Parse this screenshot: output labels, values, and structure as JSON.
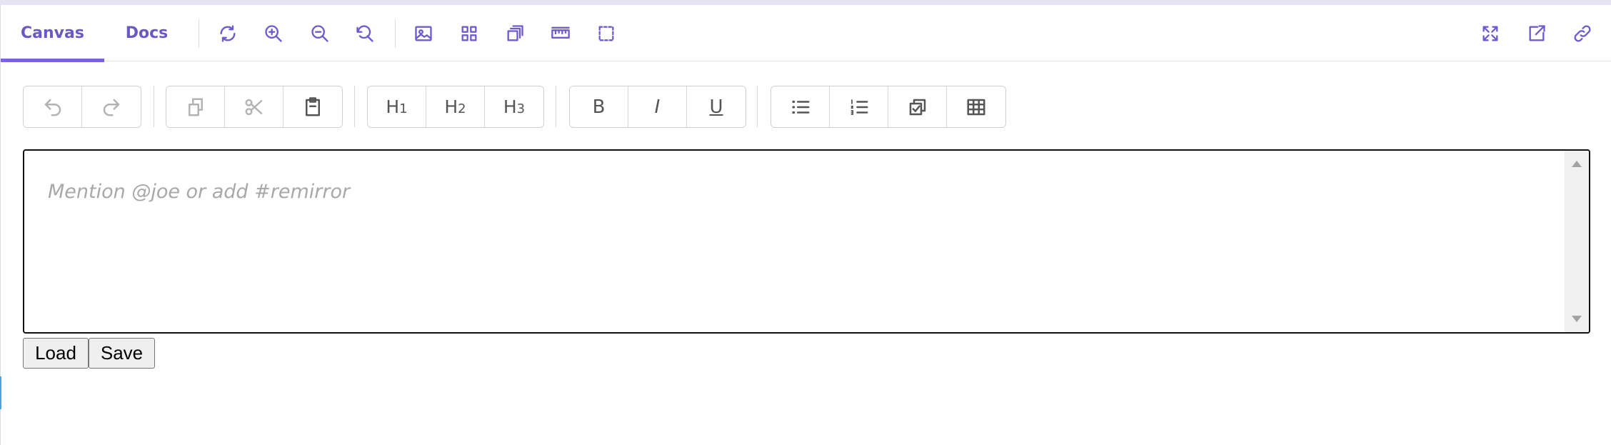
{
  "storybook": {
    "tabs": [
      {
        "label": "Canvas",
        "active": true
      },
      {
        "label": "Docs",
        "active": false
      }
    ],
    "tools": [
      "reload-icon",
      "zoom-in-icon",
      "zoom-out-icon",
      "reset-zoom-icon",
      "background-icon",
      "grid-icon",
      "viewport-icon",
      "measure-icon",
      "outline-icon"
    ],
    "right_tools": [
      "fullscreen-icon",
      "open-new-tab-icon",
      "copy-link-icon"
    ],
    "accent": "#6f5bd0"
  },
  "editor_toolbar": {
    "history": [
      "undo-icon",
      "redo-icon"
    ],
    "clipboard": [
      "copy-icon",
      "cut-icon",
      "paste-icon"
    ],
    "headings": [
      {
        "main": "H",
        "sub": "1"
      },
      {
        "main": "H",
        "sub": "2"
      },
      {
        "main": "H",
        "sub": "3"
      }
    ],
    "formatting": {
      "bold": "B",
      "italic": "I",
      "underline": "U"
    },
    "lists": [
      "bullet-list-icon",
      "ordered-list-icon",
      "task-list-icon",
      "table-icon"
    ]
  },
  "editor": {
    "placeholder": "Mention @joe or add #remirror"
  },
  "actions": {
    "load_label": "Load",
    "save_label": "Save"
  }
}
